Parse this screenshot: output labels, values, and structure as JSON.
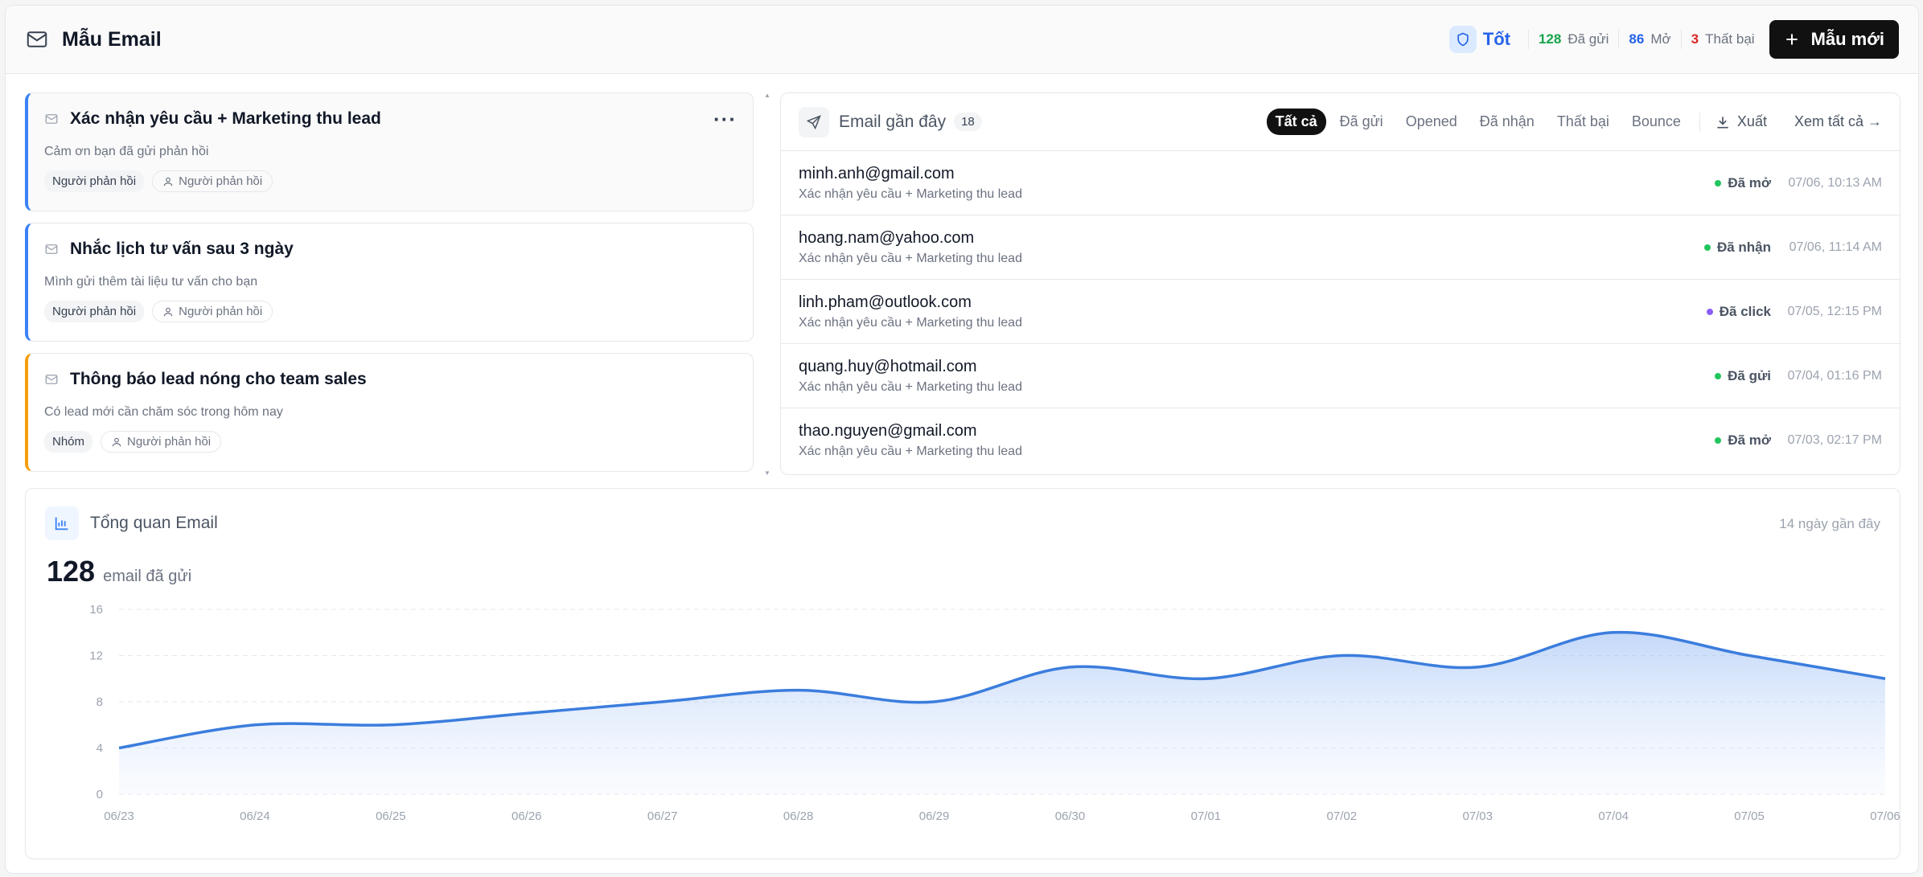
{
  "header": {
    "title": "Mẫu Email",
    "health_label": "Tốt",
    "stats": [
      {
        "num": "128",
        "label": "Đã gửi",
        "color": "#16a34a"
      },
      {
        "num": "86",
        "label": "Mở",
        "color": "#2563eb"
      },
      {
        "num": "3",
        "label": "Thất bại",
        "color": "#dc2626"
      }
    ],
    "new_button": "Mẫu mới"
  },
  "templates": [
    {
      "title": "Xác nhận yêu cầu + Marketing thu lead",
      "desc": "Cảm ơn bạn đã gửi phản hồi",
      "tag1": "Người phản hồi",
      "tag2": "Người phản hồi",
      "more": "···"
    },
    {
      "title": "Nhắc lịch tư vấn sau 3 ngày",
      "desc": "Mình gửi thêm tài liệu tư vấn cho bạn",
      "tag1": "Người phản hồi",
      "tag2": "Người phản hồi"
    },
    {
      "title": "Thông báo lead nóng cho team sales",
      "desc": "Có lead mới cần chăm sóc trong hôm nay",
      "tag1": "Nhóm",
      "tag2": "Người phản hồi"
    }
  ],
  "recent": {
    "title": "Email gần đây",
    "count": "18",
    "filters": [
      "Tất cả",
      "Đã gửi",
      "Opened",
      "Đã nhận",
      "Thất bại",
      "Bounce"
    ],
    "export": "Xuất",
    "view_all": "Xem tất cả →",
    "rows": [
      {
        "email": "minh.anh@gmail.com",
        "subject": "Xác nhận yêu cầu + Marketing thu lead",
        "status": "Đã mở",
        "dot": "#22c55e",
        "time": "07/06, 10:13 AM"
      },
      {
        "email": "hoang.nam@yahoo.com",
        "subject": "Xác nhận yêu cầu + Marketing thu lead",
        "status": "Đã nhận",
        "dot": "#22c55e",
        "time": "07/06, 11:14 AM"
      },
      {
        "email": "linh.pham@outlook.com",
        "subject": "Xác nhận yêu cầu + Marketing thu lead",
        "status": "Đã click",
        "dot": "#8b5cf6",
        "time": "07/05, 12:15 PM"
      },
      {
        "email": "quang.huy@hotmail.com",
        "subject": "Xác nhận yêu cầu + Marketing thu lead",
        "status": "Đã gửi",
        "dot": "#22c55e",
        "time": "07/04, 01:16 PM"
      },
      {
        "email": "thao.nguyen@gmail.com",
        "subject": "Xác nhận yêu cầu + Marketing thu lead",
        "status": "Đã mở",
        "dot": "#22c55e",
        "time": "07/03, 02:17 PM"
      }
    ]
  },
  "overview": {
    "title": "Tổng quan Email",
    "period": "14 ngày gần đây",
    "total": "128",
    "total_label": "email đã gửi"
  },
  "chart_data": {
    "type": "area",
    "x": [
      "06/23",
      "06/24",
      "06/25",
      "06/26",
      "06/27",
      "06/28",
      "06/29",
      "06/30",
      "07/01",
      "07/02",
      "07/03",
      "07/04",
      "07/05",
      "07/06"
    ],
    "series": [
      {
        "values": [
          4,
          6,
          6,
          7,
          8,
          9,
          8,
          11,
          10,
          12,
          11,
          14,
          12,
          10
        ]
      }
    ],
    "yticks": [
      0,
      4,
      8,
      12,
      16
    ],
    "ylim": [
      0,
      16
    ],
    "grid": true,
    "color": "#3b7ddd"
  }
}
